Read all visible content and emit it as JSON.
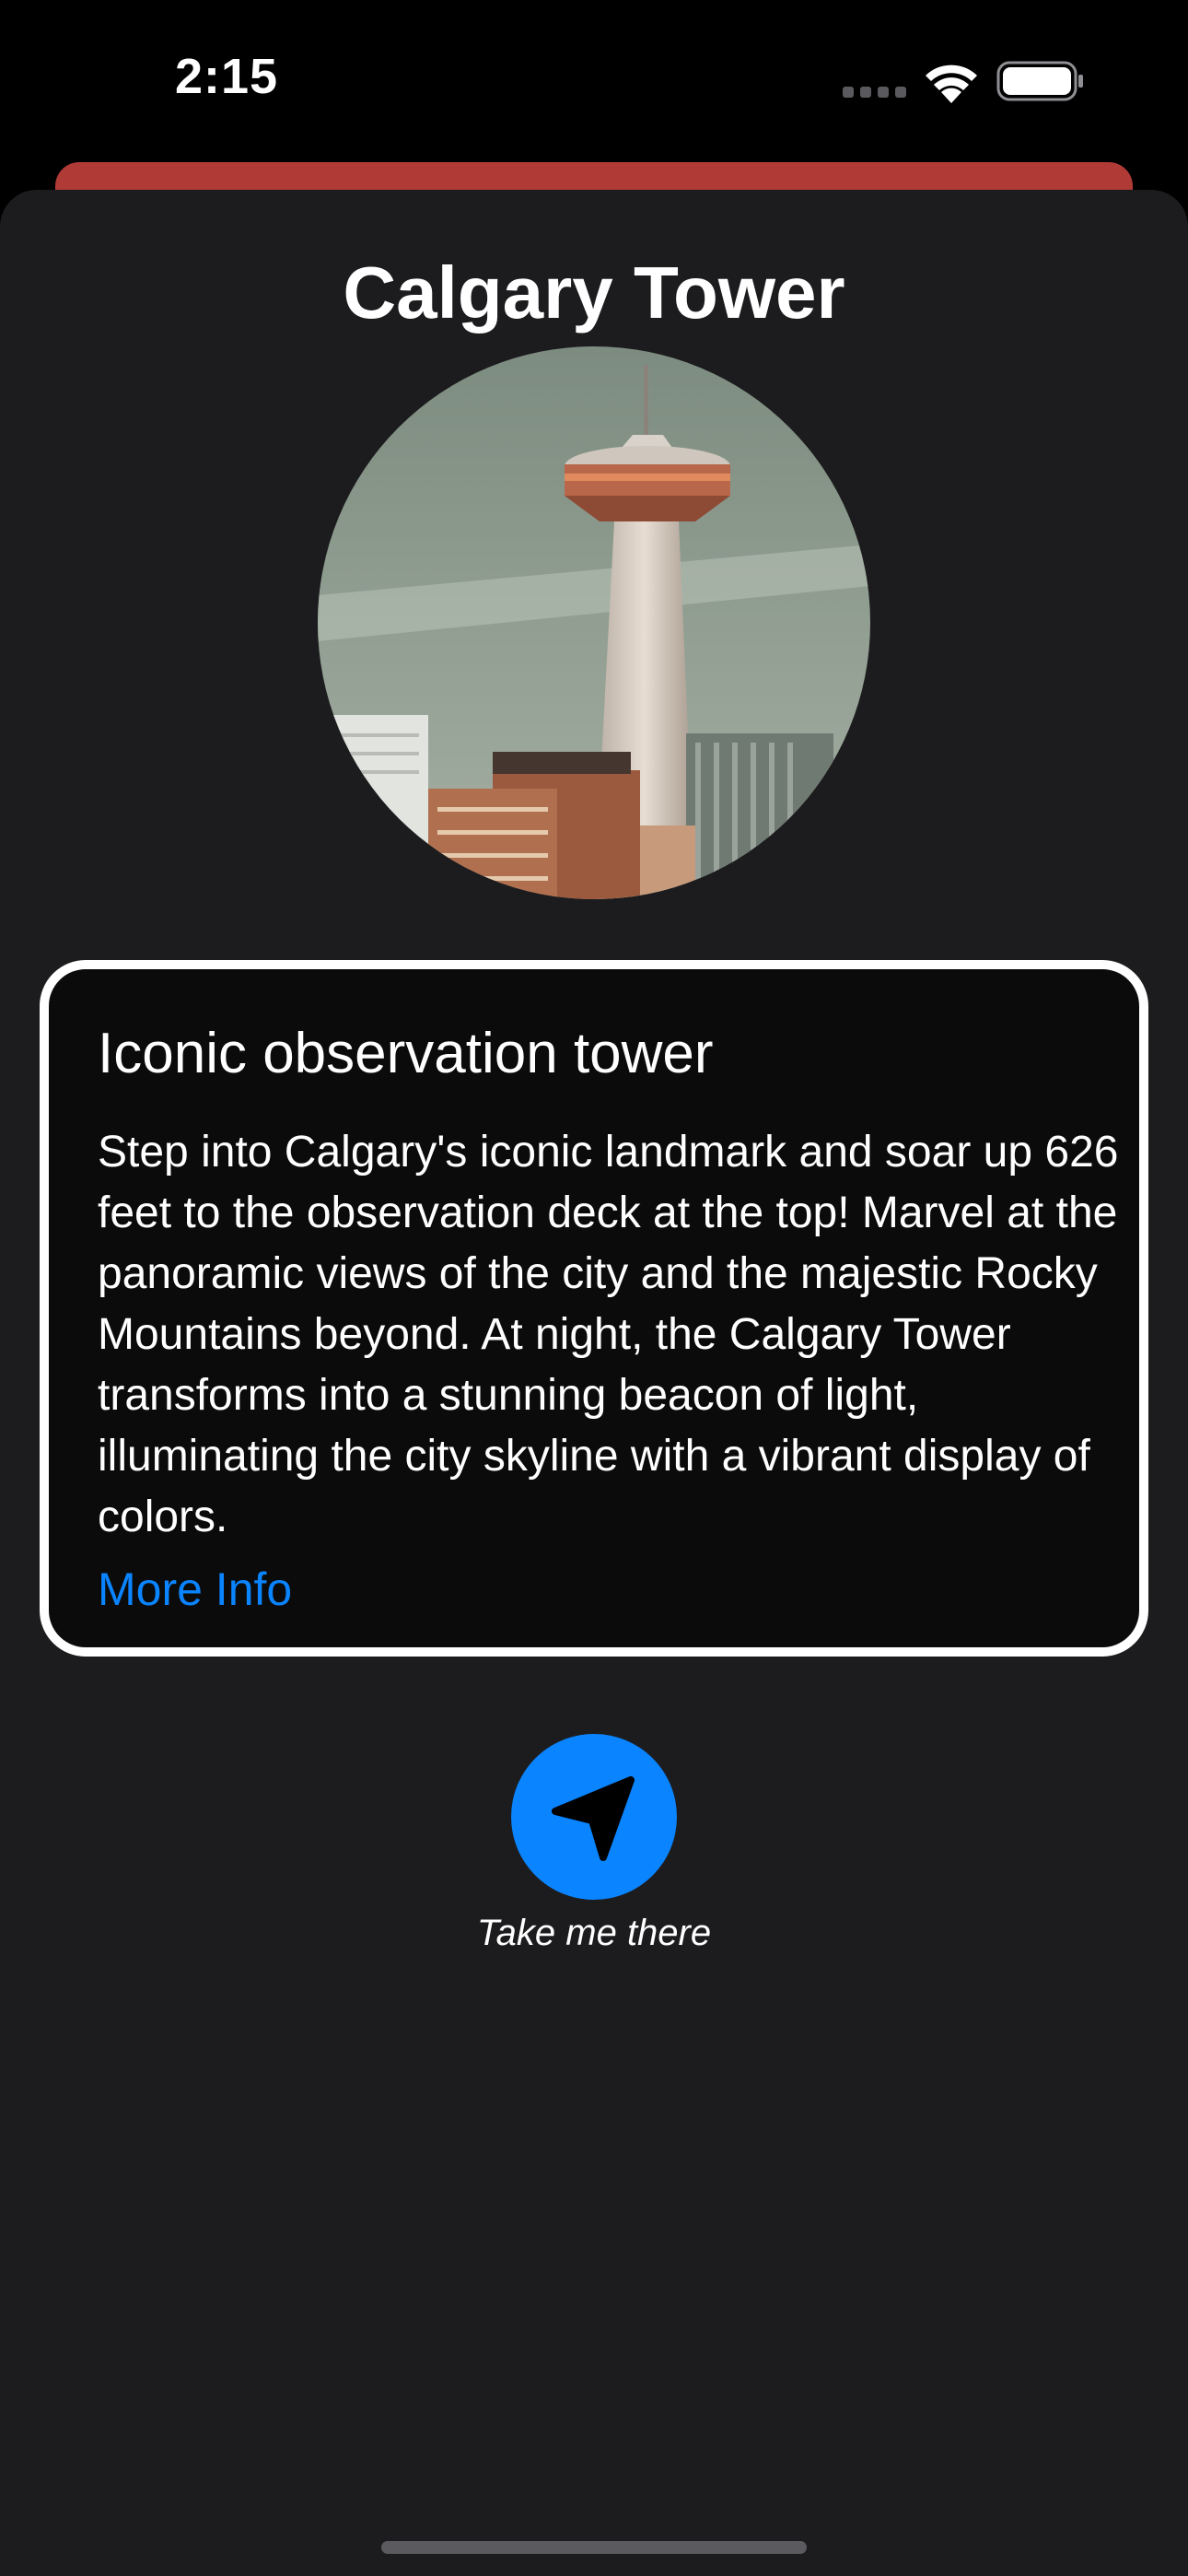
{
  "status_bar": {
    "time": "2:15",
    "cellular_icon": "cellular-dots-icon",
    "wifi_icon": "wifi-icon",
    "battery_icon": "battery-icon"
  },
  "place": {
    "title": "Calgary Tower",
    "image_icon": "calgary-tower-photo"
  },
  "description_card": {
    "heading": "Iconic observation tower",
    "body": "Step into Calgary's iconic landmark and soar up 626 feet to the observation deck at the top! Marvel at the panoramic views of the city and the majestic Rocky Mountains beyond. At night, the Calgary Tower transforms into a stunning beacon of light, illuminating the city skyline with a vibrant display of colors.",
    "link_label": "More Info"
  },
  "navigation": {
    "button_icon": "location-arrow-icon",
    "label": "Take me there"
  },
  "colors": {
    "accent": "#0a84ff",
    "sheet_background": "#1c1c1e",
    "card_background": "#0b0b0b",
    "underlying_sheet": "#b03a36"
  }
}
